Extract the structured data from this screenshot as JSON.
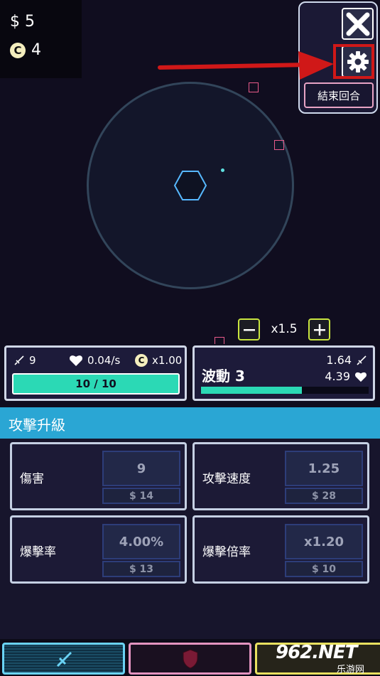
{
  "currency": {
    "money": "$ 5",
    "coins": "4",
    "coin_symbol": "C"
  },
  "top_panel": {
    "end_round_label": "結束回合",
    "close_icon": "close-icon",
    "settings_icon": "gear-icon"
  },
  "speed": {
    "minus_label": "−",
    "plus_label": "+",
    "multiplier": "x1.5"
  },
  "player_stats": {
    "damage": "9",
    "regen": "0.04/s",
    "coin_multiplier": "x1.00",
    "hp": "10 / 10",
    "hp_fraction": 1.0
  },
  "wave": {
    "title": "波動 3",
    "enemy_damage": "1.64",
    "enemy_health": "4.39",
    "progress_fraction": 0.6
  },
  "upgrades": {
    "section_title": "攻擊升級",
    "cards": [
      {
        "name": "傷害",
        "value": "9",
        "cost": "$ 14"
      },
      {
        "name": "攻擊速度",
        "value": "1.25",
        "cost": "$ 28"
      },
      {
        "name": "爆擊率",
        "value": "4.00%",
        "cost": "$ 13"
      },
      {
        "name": "爆擊倍率",
        "value": "x1.20",
        "cost": "$ 10"
      }
    ]
  },
  "tabs": {
    "attack_icon": "sword-icon",
    "defense_icon": "shield-icon"
  },
  "watermark": {
    "main": "962.NET",
    "sub": "乐游网"
  },
  "colors": {
    "accent_teal": "#2bd9b5",
    "section_blue": "#2aa6d4",
    "highlight_red": "#d01818",
    "speed_green": "#c9e53f"
  }
}
